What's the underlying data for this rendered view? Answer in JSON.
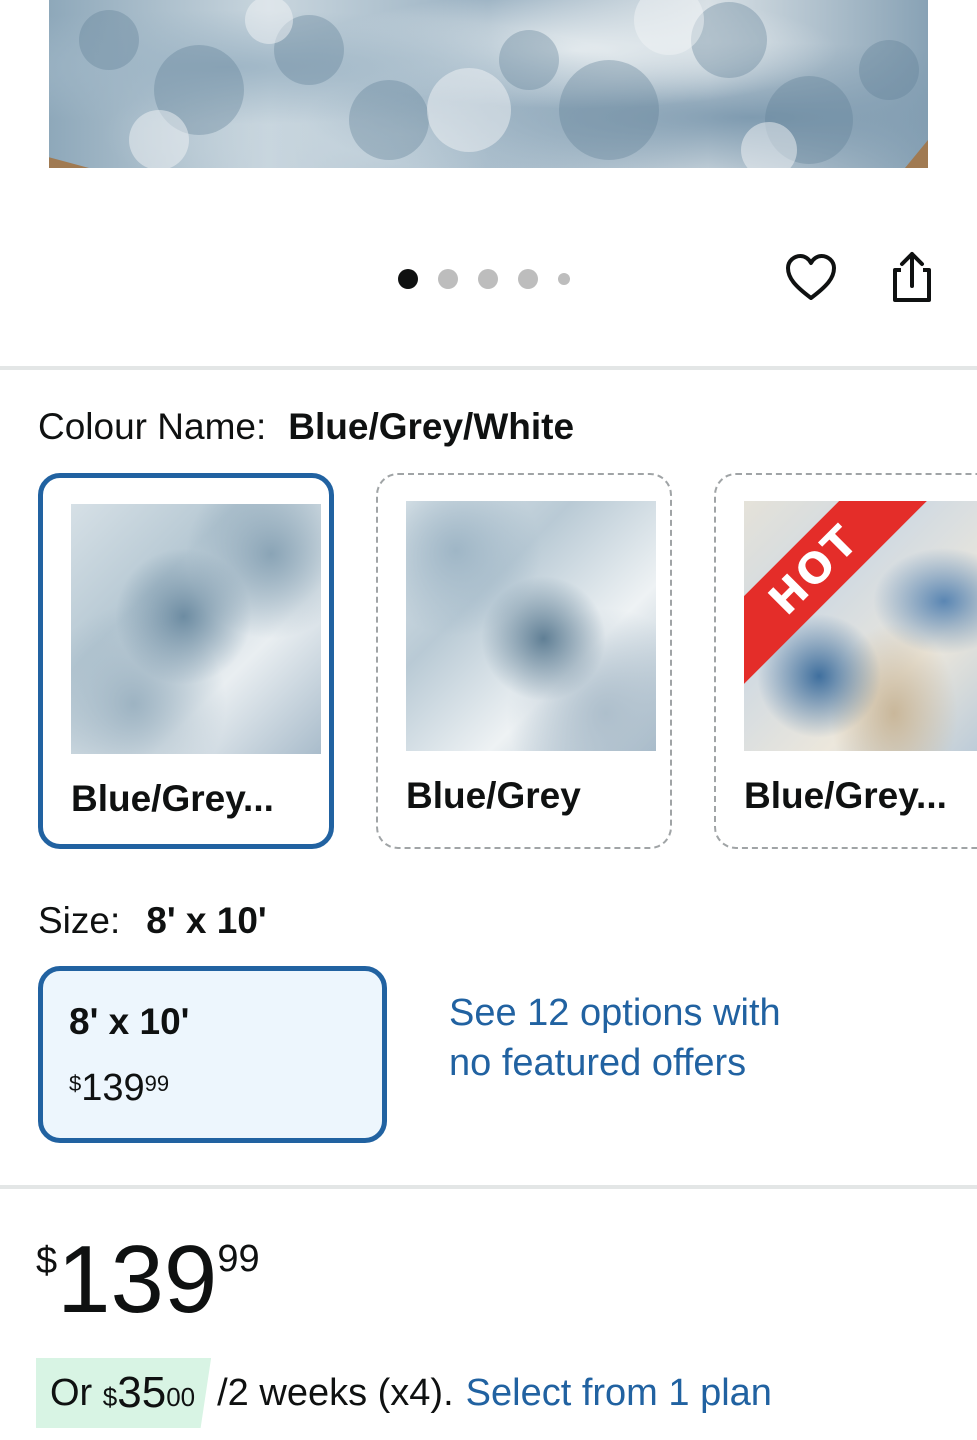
{
  "gallery": {
    "dot_count": 5,
    "active_index": 0
  },
  "colour": {
    "label": "Colour Name:",
    "selected": "Blue/Grey/White",
    "options": [
      {
        "name": "Blue/Grey...",
        "selected": true,
        "badge": ""
      },
      {
        "name": "Blue/Grey",
        "selected": false,
        "badge": ""
      },
      {
        "name": "Blue/Grey...",
        "selected": false,
        "badge": "HOT"
      }
    ]
  },
  "size": {
    "label": "Size:",
    "selected": "8' x 10'",
    "option": {
      "name": "8' x 10'",
      "currency": "$",
      "price_whole": "139",
      "price_cents": "99"
    },
    "see_options": "See 12 options with no featured offers"
  },
  "price": {
    "currency": "$",
    "whole": "139",
    "cents": "99"
  },
  "plan": {
    "prefix": "Or",
    "currency": "$",
    "whole": "35",
    "cents": "00",
    "suffix": "/2 weeks (x4).",
    "link": "Select from 1 plan"
  },
  "colors": {
    "accent": "#2162a1",
    "selected_bg": "#edf6fd",
    "plan_badge_bg": "#d8f4e4",
    "hot_badge": "#e42d29"
  }
}
